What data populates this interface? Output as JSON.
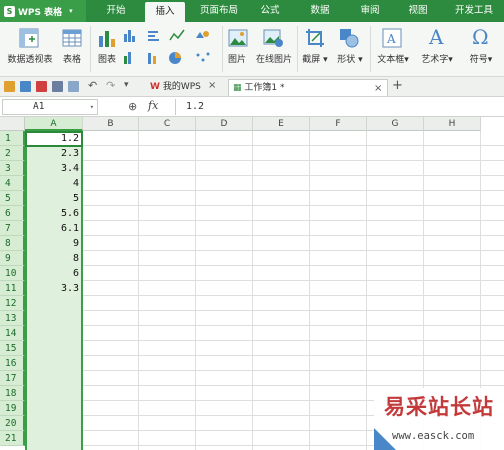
{
  "app": {
    "title": "WPS 表格"
  },
  "menu": {
    "tabs": [
      {
        "label": "开始"
      },
      {
        "label": "插入"
      },
      {
        "label": "页面布局"
      },
      {
        "label": "公式"
      },
      {
        "label": "数据"
      },
      {
        "label": "审阅"
      },
      {
        "label": "视图"
      },
      {
        "label": "开发工具"
      }
    ],
    "active_tab": "插入"
  },
  "ribbon": {
    "pivot": "数据透视表",
    "table": "表格",
    "chart": "图表",
    "picture": "图片",
    "online_picture": "在线图片",
    "screenshot": "截屏",
    "shapes": "形状",
    "textbox": "文本框",
    "wordart": "艺术字",
    "symbol": "符号"
  },
  "doc_tabs": {
    "my_wps": "我的WPS",
    "workbook": "工作簿1 *"
  },
  "formula_bar": {
    "name_box": "A1",
    "fx": "fx",
    "value": "1.2"
  },
  "sheet": {
    "columns": [
      "A",
      "B",
      "C",
      "D",
      "E",
      "F",
      "G",
      "H"
    ],
    "rows": [
      "1",
      "2",
      "3",
      "4",
      "5",
      "6",
      "7",
      "8",
      "9",
      "10",
      "11",
      "12",
      "13",
      "14",
      "15",
      "16",
      "17",
      "18",
      "19",
      "20",
      "21"
    ],
    "column_a": [
      "1.2",
      "2.3",
      "3.4",
      "4",
      "5",
      "5.6",
      "6.1",
      "9",
      "8",
      "6",
      "3.3"
    ]
  },
  "watermark": {
    "title": "易采站长站",
    "url": "www.easck.com"
  },
  "colors": {
    "brand_green": "#2c8b3e",
    "selection_green": "#3a9e49",
    "selection_fill": "#dff0dc"
  }
}
